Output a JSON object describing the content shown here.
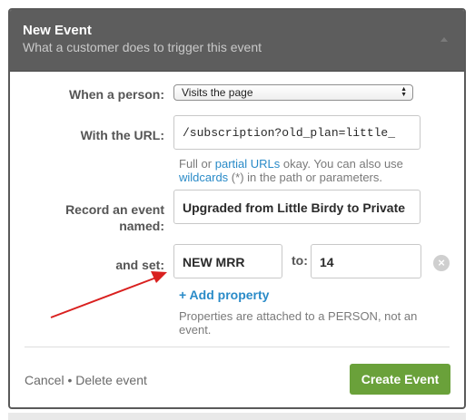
{
  "header": {
    "title": "New Event",
    "subtitle": "What a customer does to trigger this event"
  },
  "form": {
    "when_label": "When a person:",
    "when_value": "Visits the page",
    "url_label": "With the URL:",
    "url_value": "/subscription?old_plan=little_",
    "url_help": {
      "pre": "Full or ",
      "link1": "partial URLs",
      "mid": " okay. You can also use",
      "link2": "wildcards",
      "post": " (*) in the path or parameters."
    },
    "record_label_line1": "Record an event",
    "record_label_line2": "named:",
    "record_value": "Upgraded from Little Birdy to Private",
    "set_label": "and set:",
    "property_name": "NEW MRR",
    "to_label": "to:",
    "property_value": "14",
    "add_property": "+ Add property",
    "properties_help_line1": "Properties are attached to a PERSON, not an",
    "properties_help_line2": "event."
  },
  "footer": {
    "cancel": "Cancel",
    "separator": "•",
    "delete": "Delete event",
    "create": "Create Event"
  },
  "colors": {
    "header_bg": "#5d5d5d",
    "link": "#2a8bc8",
    "create_button": "#6aa13a",
    "annotation_arrow": "#d9201f"
  },
  "icons": {
    "collapse": "caret-up-icon",
    "remove_property": "remove-circle-icon",
    "select_arrows": "updown-arrows-icon"
  }
}
